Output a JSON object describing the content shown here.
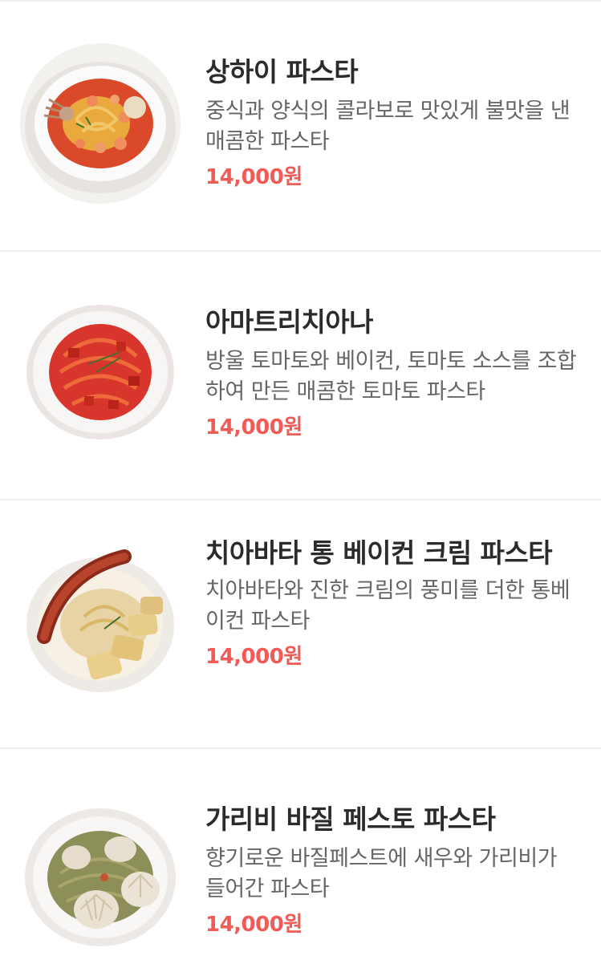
{
  "menu": {
    "items": [
      {
        "name": "상하이 파스타",
        "description": "중식과 양식의 콜라보로 맛있게 불맛을 낸 매콤한 파스타",
        "price": "14,000원",
        "image_icon": "shanghai-pasta-photo"
      },
      {
        "name": "아마트리치아나",
        "description": "방울 토마토와 베이컨, 토마토 소스를 조합하여 만든 매콤한 토마토 파스타",
        "price": "14,000원",
        "image_icon": "amatriciana-pasta-photo"
      },
      {
        "name": "치아바타 통 베이컨 크림 파스타",
        "description": "치아바타와 진한 크림의 풍미를 더한 통베이컨 파스타",
        "price": "14,000원",
        "image_icon": "ciabatta-bacon-cream-pasta-photo"
      },
      {
        "name": "가리비 바질 페스토 파스타",
        "description": "향기로운 바질페스트에 새우와 가리비가 들어간 파스타",
        "price": "14,000원",
        "image_icon": "scallop-basil-pesto-pasta-photo"
      }
    ]
  },
  "colors": {
    "price": "#f25a55",
    "title": "#2b2b2b",
    "description": "#666666",
    "divider": "#ececec"
  }
}
